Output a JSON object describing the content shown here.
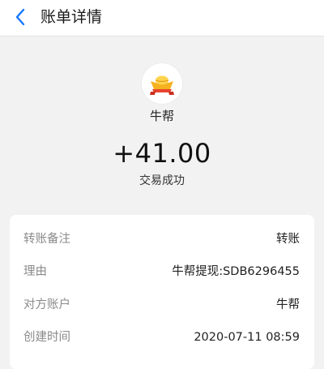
{
  "header": {
    "title": "账单详情",
    "back_icon": "chevron-left-icon"
  },
  "summary": {
    "merchant_icon": "gold-ingot-icon",
    "merchant_name": "牛帮",
    "amount": "+41.00",
    "status": "交易成功"
  },
  "details": [
    {
      "label": "转账备注",
      "value": "转账"
    },
    {
      "label": "理由",
      "value": "牛帮提现:SDB6296455"
    },
    {
      "label": "对方账户",
      "value": "牛帮"
    },
    {
      "label": "创建时间",
      "value": "2020-07-11 08:59"
    }
  ],
  "colors": {
    "accent": "#1677ff",
    "background": "#f2f2f2",
    "card": "#ffffff",
    "label": "#8a8a8a"
  }
}
